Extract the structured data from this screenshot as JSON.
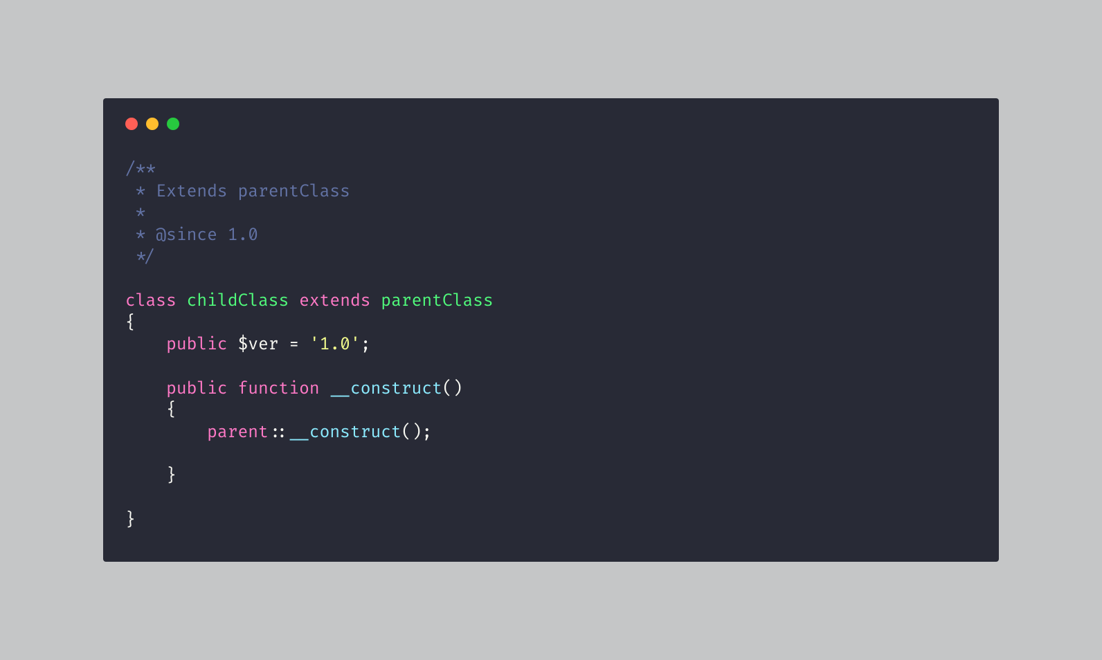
{
  "window": {
    "buttons": [
      "close",
      "minimize",
      "zoom"
    ]
  },
  "code": {
    "line1": "/**",
    "line2": " * Extends parentClass",
    "line3": " *",
    "line4": " * @since 1.0",
    "line5": " */",
    "blank1": "",
    "l7_class": "class",
    "l7_child": "childClass",
    "l7_extends": "extends",
    "l7_parent": "parentClass",
    "l8": "{",
    "l9_indent": "    ",
    "l9_public": "public",
    "l9_var": " $ver ",
    "l9_eq": "=",
    "l9_str": " '1.0'",
    "l9_semi": ";",
    "blank2": "",
    "l11_indent": "    ",
    "l11_public": "public",
    "l11_func": " function ",
    "l11_name": "__construct",
    "l11_paren": "()",
    "l12": "    {",
    "l13_indent": "        ",
    "l13_parent": "parent",
    "l13_dbl": "::",
    "l13_name": "__construct",
    "l13_paren": "();",
    "blank3": "",
    "l15": "    }",
    "blank4": "",
    "l17": "}"
  },
  "colors": {
    "bg_page": "#c5c6c7",
    "bg_window": "#282a36",
    "red": "#ff5f56",
    "yellow": "#ffbd2e",
    "green": "#27c93f",
    "comment": "#6272a4",
    "keyword": "#ff79c6",
    "class": "#50fa7b",
    "func": "#8be9fd",
    "string": "#f1fa8c",
    "text": "#f8f8f2"
  }
}
